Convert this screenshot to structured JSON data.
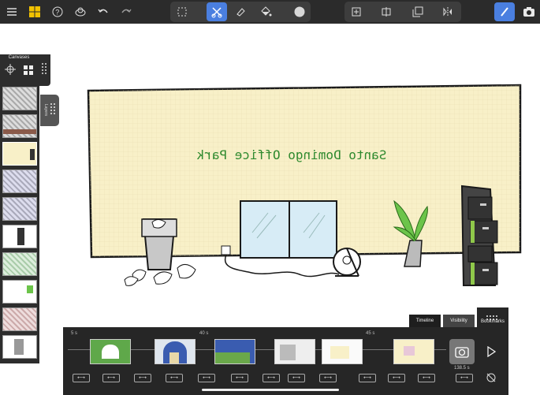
{
  "toolbar": {
    "menu_icon": "hamburger-icon",
    "tools": [
      "marquee-select-icon",
      "lasso-cut-icon",
      "eraser-icon",
      "fill-bucket-icon",
      "color-picker-icon"
    ],
    "transform_tools": [
      "add-frame-icon",
      "split-icon",
      "duplicate-icon",
      "flip-icon"
    ],
    "selected_tool": "lasso-cut-icon",
    "accent_color": "#4a7fe0"
  },
  "canvases": {
    "title": "Canvases",
    "layers_tab_label": "Layers"
  },
  "scene": {
    "sign_text": "Santo Domingo Office Park",
    "sign_color": "#2f8a2f",
    "wall_color": "#f8f0c8"
  },
  "timeline": {
    "tabs": [
      "Timeline",
      "Visibility",
      "Bookmarks"
    ],
    "ruler_labels": [
      "5 s",
      "40 s",
      "45 s"
    ],
    "end_time": "138.5 s"
  }
}
